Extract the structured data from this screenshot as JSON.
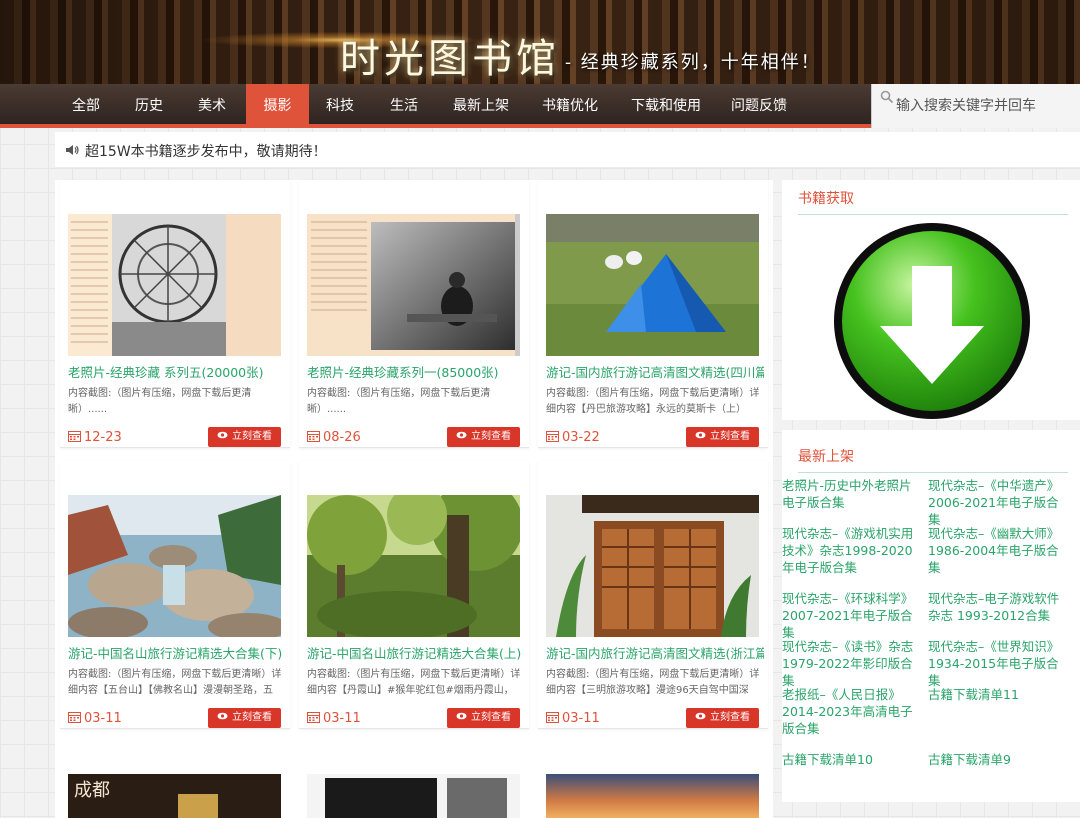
{
  "header": {
    "title": "时光图书馆",
    "subtitle": "- 经典珍藏系列，十年相伴！"
  },
  "nav": {
    "items": [
      "全部",
      "历史",
      "美术",
      "摄影",
      "科技",
      "生活",
      "最新上架",
      "书籍优化",
      "下载和使用",
      "问题反馈"
    ],
    "active_index": 3
  },
  "search": {
    "placeholder": "输入搜索关键字并回车"
  },
  "notice": {
    "text": "超15W本书籍逐步发布中，敬请期待！"
  },
  "cards": [
    {
      "title": "老照片-经典珍藏 系列五(20000张)",
      "desc": "内容截图:（图片有压缩，网盘下载后更清晰）......",
      "date": "12-23",
      "button": "立刻查看"
    },
    {
      "title": "老照片-经典珍藏系列一(85000张)",
      "desc": "内容截图:（图片有压缩，网盘下载后更清晰）......",
      "date": "08-26",
      "button": "立刻查看"
    },
    {
      "title": "游记-国内旅行游记高清图文精选(四川篇)",
      "desc": "内容截图:（图片有压缩，网盘下载后更清晰）详细内容【丹巴旅游攻略】永远的莫斯卡（上）",
      "date": "03-22",
      "button": "立刻查看"
    },
    {
      "title": "游记-中国名山旅行游记精选大合集(下)",
      "desc": "内容截图:（图片有压缩，网盘下载后更清晰）详细内容【五台山】【佛教名山】漫漫朝圣路，五",
      "date": "03-11",
      "button": "立刻查看"
    },
    {
      "title": "游记-中国名山旅行游记精选大合集(上)",
      "desc": "内容截图:（图片有压缩，网盘下载后更清晰）详细内容【丹霞山】#猴年驼红包#烟雨丹霞山，",
      "date": "03-11",
      "button": "立刻查看"
    },
    {
      "title": "游记-国内旅行游记高清图文精选(浙江篇)",
      "desc": "内容截图:（图片有压缩，网盘下载后更清晰）详细内容【三明旅游攻略】漫途96天自驾中国深",
      "date": "03-11",
      "button": "立刻查看"
    }
  ],
  "sidebar": {
    "get_books": {
      "title": "书籍获取"
    },
    "new_arrivals": {
      "title": "最新上架",
      "links": [
        "老照片-历史中外老照片电子版合集",
        "现代杂志–《中华遗产》2006-2021年电子版合集",
        "现代杂志–《游戏机实用技术》杂志1998-2020年电子版合集",
        "现代杂志–《幽默大师》1986-2004年电子版合集",
        "现代杂志–《环球科学》2007-2021年电子版合集",
        "现代杂志–电子游戏软件杂志 1993-2012合集",
        "现代杂志–《读书》杂志1979-2022年影印版合集",
        "现代杂志–《世界知识》1934-2015年电子版合集",
        "老报纸–《人民日报》2014-2023年高清电子版合集",
        "古籍下载清单11",
        "古籍下载清单10",
        "古籍下载清单9"
      ]
    }
  },
  "partial_row": {
    "thumb_text": "成都"
  },
  "colors": {
    "accent": "#e0533b",
    "link_green": "#2aa46a",
    "button_red": "#d9362a",
    "nav_bg": "#3b2e28"
  }
}
